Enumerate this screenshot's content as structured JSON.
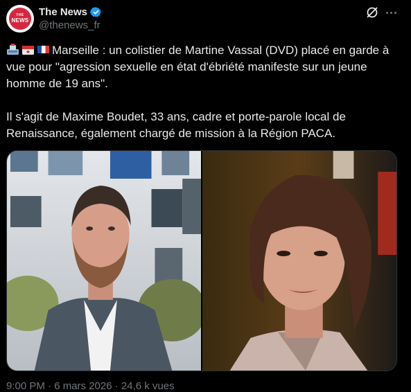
{
  "author": {
    "display_name": "The News",
    "handle": "@thenews_fr",
    "avatar_text_top": "THE",
    "avatar_text_bottom": "NEWS"
  },
  "tweet": {
    "paragraph1": "Marseille : un colistier de Martine Vassal (DVD) placé en garde à vue pour \"agression sexuelle en état d'ébriété manifeste sur un jeune homme de 19 ans\".",
    "paragraph2": "Il s'agit de Maxime Boudet, 33 ans, cadre et porte-parole local de Renaissance, également chargé de mission à la Région PACA.",
    "emojis": [
      "police-car-light-emoji",
      "briefcase-emoji",
      "france-flag-emoji"
    ]
  },
  "footer": {
    "timestamp": "9:00 PM · 6 mars 2026 · 24,6 k vues"
  },
  "colors": {
    "background": "#000000",
    "text_primary": "#e7e9ea",
    "text_secondary": "#71767b",
    "verified": "#1d9bf0",
    "avatar_red": "#d6273f"
  }
}
